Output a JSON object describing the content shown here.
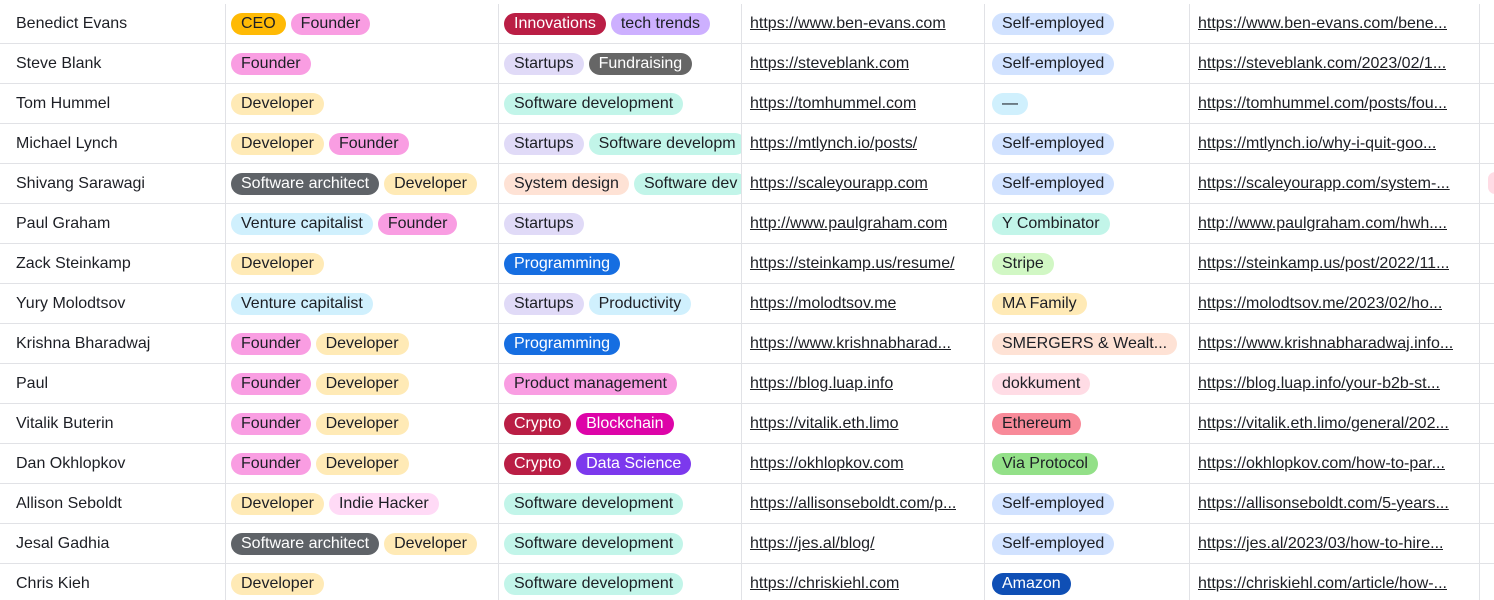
{
  "rows": [
    {
      "name": "Benedict Evans",
      "roles": [
        {
          "label": "CEO",
          "bg": "#ffba05",
          "fg": "#1d1f25"
        },
        {
          "label": "Founder",
          "bg": "#f99de2",
          "fg": "#1d1f25"
        }
      ],
      "topics": [
        {
          "label": "Innovations",
          "bg": "#ba1e45",
          "fg": "#ffffff"
        },
        {
          "label": "tech trends",
          "bg": "#cdb0ff",
          "fg": "#1d1f25"
        }
      ],
      "site": "https://www.ben-evans.com",
      "org": {
        "label": "Self-employed",
        "bg": "#d1e2ff",
        "fg": "#1d1f25"
      },
      "post": "https://www.ben-evans.com/bene..."
    },
    {
      "name": "Steve Blank",
      "roles": [
        {
          "label": "Founder",
          "bg": "#f99de2",
          "fg": "#1d1f25"
        }
      ],
      "topics": [
        {
          "label": "Startups",
          "bg": "#e0daf7",
          "fg": "#1d1f25"
        },
        {
          "label": "Fundraising",
          "bg": "#666666",
          "fg": "#ffffff"
        }
      ],
      "site": "https://steveblank.com",
      "org": {
        "label": "Self-employed",
        "bg": "#d1e2ff",
        "fg": "#1d1f25"
      },
      "post": "https://steveblank.com/2023/02/1..."
    },
    {
      "name": "Tom Hummel",
      "roles": [
        {
          "label": "Developer",
          "bg": "#ffeab6",
          "fg": "#1d1f25"
        }
      ],
      "topics": [
        {
          "label": "Software development",
          "bg": "#c2f5e9",
          "fg": "#1d1f25"
        }
      ],
      "site": "https://tomhummel.com",
      "org": {
        "label": "—",
        "bg": "#d0f0fd",
        "fg": "#1d1f25"
      },
      "post": "https://tomhummel.com/posts/fou..."
    },
    {
      "name": "Michael Lynch",
      "roles": [
        {
          "label": "Developer",
          "bg": "#ffeab6",
          "fg": "#1d1f25"
        },
        {
          "label": "Founder",
          "bg": "#f99de2",
          "fg": "#1d1f25"
        }
      ],
      "topics": [
        {
          "label": "Startups",
          "bg": "#e0daf7",
          "fg": "#1d1f25"
        },
        {
          "label": "Software developm",
          "bg": "#c2f5e9",
          "fg": "#1d1f25"
        }
      ],
      "site": "https://mtlynch.io/posts/",
      "org": {
        "label": "Self-employed",
        "bg": "#d1e2ff",
        "fg": "#1d1f25"
      },
      "post": "https://mtlynch.io/why-i-quit-goo..."
    },
    {
      "name": "Shivang Sarawagi",
      "roles": [
        {
          "label": "Software architect",
          "bg": "#5f6368",
          "fg": "#ffffff"
        },
        {
          "label": "Developer",
          "bg": "#ffeab6",
          "fg": "#1d1f25"
        }
      ],
      "topics": [
        {
          "label": "System design",
          "bg": "#fee2d5",
          "fg": "#1d1f25"
        },
        {
          "label": "Software dev",
          "bg": "#c2f5e9",
          "fg": "#1d1f25"
        }
      ],
      "site": "https://scaleyourapp.com",
      "org": {
        "label": "Self-employed",
        "bg": "#d1e2ff",
        "fg": "#1d1f25"
      },
      "post": "https://scaleyourapp.com/system-..."
    },
    {
      "name": "Paul Graham",
      "roles": [
        {
          "label": "Venture capitalist",
          "bg": "#d0f0fd",
          "fg": "#1d1f25"
        },
        {
          "label": "Founder",
          "bg": "#f99de2",
          "fg": "#1d1f25"
        }
      ],
      "topics": [
        {
          "label": "Startups",
          "bg": "#e0daf7",
          "fg": "#1d1f25"
        }
      ],
      "site": "http://www.paulgraham.com",
      "org": {
        "label": "Y Combinator",
        "bg": "#c2f5e9",
        "fg": "#1d1f25"
      },
      "post": "http://www.paulgraham.com/hwh...."
    },
    {
      "name": "Zack Steinkamp",
      "roles": [
        {
          "label": "Developer",
          "bg": "#ffeab6",
          "fg": "#1d1f25"
        }
      ],
      "topics": [
        {
          "label": "Programming",
          "bg": "#166ee1",
          "fg": "#ffffff"
        }
      ],
      "site": "https://steinkamp.us/resume/",
      "org": {
        "label": "Stripe",
        "bg": "#d1f7c4",
        "fg": "#1d1f25"
      },
      "post": "https://steinkamp.us/post/2022/11..."
    },
    {
      "name": "Yury Molodtsov",
      "roles": [
        {
          "label": "Venture capitalist",
          "bg": "#d0f0fd",
          "fg": "#1d1f25"
        }
      ],
      "topics": [
        {
          "label": "Startups",
          "bg": "#e0daf7",
          "fg": "#1d1f25"
        },
        {
          "label": "Productivity",
          "bg": "#d0f0fd",
          "fg": "#1d1f25"
        }
      ],
      "site": "https://molodtsov.me",
      "org": {
        "label": "MA Family",
        "bg": "#ffeab6",
        "fg": "#1d1f25"
      },
      "post": "https://molodtsov.me/2023/02/ho..."
    },
    {
      "name": "Krishna Bharadwaj",
      "roles": [
        {
          "label": "Founder",
          "bg": "#f99de2",
          "fg": "#1d1f25"
        },
        {
          "label": "Developer",
          "bg": "#ffeab6",
          "fg": "#1d1f25"
        }
      ],
      "topics": [
        {
          "label": "Programming",
          "bg": "#166ee1",
          "fg": "#ffffff"
        }
      ],
      "site": "https://www.krishnabharad...",
      "org": {
        "label": "SMERGERS & Wealt...",
        "bg": "#fee2d5",
        "fg": "#1d1f25"
      },
      "post": "https://www.krishnabharadwaj.info..."
    },
    {
      "name": "Paul",
      "roles": [
        {
          "label": "Founder",
          "bg": "#f99de2",
          "fg": "#1d1f25"
        },
        {
          "label": "Developer",
          "bg": "#ffeab6",
          "fg": "#1d1f25"
        }
      ],
      "topics": [
        {
          "label": "Product management",
          "bg": "#f99de2",
          "fg": "#1d1f25"
        }
      ],
      "site": "https://blog.luap.info",
      "org": {
        "label": "dokkument",
        "bg": "#ffdce5",
        "fg": "#1d1f25"
      },
      "post": "https://blog.luap.info/your-b2b-st..."
    },
    {
      "name": "Vitalik Buterin",
      "roles": [
        {
          "label": "Founder",
          "bg": "#f99de2",
          "fg": "#1d1f25"
        },
        {
          "label": "Developer",
          "bg": "#ffeab6",
          "fg": "#1d1f25"
        }
      ],
      "topics": [
        {
          "label": "Crypto",
          "bg": "#ba1e45",
          "fg": "#ffffff"
        },
        {
          "label": "Blockchain",
          "bg": "#dd04a8",
          "fg": "#ffffff"
        }
      ],
      "site": "https://vitalik.eth.limo",
      "org": {
        "label": "Ethereum",
        "bg": "#f88a99",
        "fg": "#1d1f25"
      },
      "post": "https://vitalik.eth.limo/general/202..."
    },
    {
      "name": "Dan Okhlopkov",
      "roles": [
        {
          "label": "Founder",
          "bg": "#f99de2",
          "fg": "#1d1f25"
        },
        {
          "label": "Developer",
          "bg": "#ffeab6",
          "fg": "#1d1f25"
        }
      ],
      "topics": [
        {
          "label": "Crypto",
          "bg": "#ba1e45",
          "fg": "#ffffff"
        },
        {
          "label": "Data Science",
          "bg": "#7c39ed",
          "fg": "#ffffff"
        }
      ],
      "site": "https://okhlopkov.com",
      "org": {
        "label": "Via Protocol",
        "bg": "#93e088",
        "fg": "#1d1f25"
      },
      "post": "https://okhlopkov.com/how-to-par..."
    },
    {
      "name": "Allison Seboldt",
      "roles": [
        {
          "label": "Developer",
          "bg": "#ffeab6",
          "fg": "#1d1f25"
        },
        {
          "label": "Indie Hacker",
          "bg": "#ffdaf6",
          "fg": "#1d1f25"
        }
      ],
      "topics": [
        {
          "label": "Software development",
          "bg": "#c2f5e9",
          "fg": "#1d1f25"
        }
      ],
      "site": "https://allisonseboldt.com/p...",
      "org": {
        "label": "Self-employed",
        "bg": "#d1e2ff",
        "fg": "#1d1f25"
      },
      "post": "https://allisonseboldt.com/5-years..."
    },
    {
      "name": "Jesal Gadhia",
      "roles": [
        {
          "label": "Software architect",
          "bg": "#5f6368",
          "fg": "#ffffff"
        },
        {
          "label": "Developer",
          "bg": "#ffeab6",
          "fg": "#1d1f25"
        }
      ],
      "topics": [
        {
          "label": "Software development",
          "bg": "#c2f5e9",
          "fg": "#1d1f25"
        }
      ],
      "site": "https://jes.al/blog/",
      "org": {
        "label": "Self-employed",
        "bg": "#d1e2ff",
        "fg": "#1d1f25"
      },
      "post": "https://jes.al/2023/03/how-to-hire..."
    },
    {
      "name": "Chris Kieh",
      "roles": [
        {
          "label": "Developer",
          "bg": "#ffeab6",
          "fg": "#1d1f25"
        }
      ],
      "topics": [
        {
          "label": "Software development",
          "bg": "#c2f5e9",
          "fg": "#1d1f25"
        }
      ],
      "site": "https://chriskiehl.com",
      "org": {
        "label": "Amazon",
        "bg": "#0f4fb5",
        "fg": "#ffffff"
      },
      "post": "https://chriskiehl.com/article/how-..."
    }
  ]
}
